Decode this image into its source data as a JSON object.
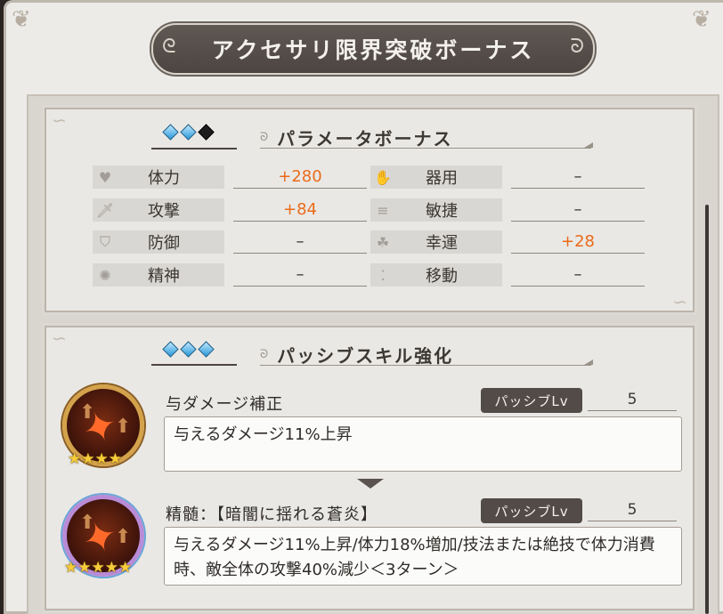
{
  "header": {
    "title": "アクセサリ限界突破ボーナス"
  },
  "param_section": {
    "title": "パラメータボーナス",
    "gems": [
      "blue",
      "blue",
      "black"
    ],
    "stats": [
      {
        "icon": "heart-icon",
        "glyph": "♥",
        "label": "体力",
        "value": "+280",
        "positive": true
      },
      {
        "icon": "hand-icon",
        "glyph": "✋",
        "label": "器用",
        "value": "–",
        "positive": false
      },
      {
        "icon": "sword-icon",
        "glyph": "🗡",
        "label": "攻撃",
        "value": "+84",
        "positive": true
      },
      {
        "icon": "speed-lines-icon",
        "glyph": "≡",
        "label": "敏捷",
        "value": "–",
        "positive": false
      },
      {
        "icon": "shield-icon",
        "glyph": "⛉",
        "label": "防御",
        "value": "–",
        "positive": false
      },
      {
        "icon": "clover-icon",
        "glyph": "☘",
        "label": "幸運",
        "value": "+28",
        "positive": true
      },
      {
        "icon": "spirit-icon",
        "glyph": "✺",
        "label": "精神",
        "value": "–",
        "positive": false
      },
      {
        "icon": "footprints-icon",
        "glyph": "⁚",
        "label": "移動",
        "value": "–",
        "positive": false
      }
    ]
  },
  "passive_section": {
    "title": "パッシブスキル強化",
    "gems": [
      "blue",
      "blue",
      "blue"
    ],
    "skills": [
      {
        "name": "与ダメージ補正",
        "lv_label": "パッシブLv",
        "lv_value": "5",
        "description": "与えるダメージ11%上昇",
        "stars": "★★★★"
      },
      {
        "name": "精髄：【暗闇に揺れる蒼炎】",
        "lv_label": "パッシブLv",
        "lv_value": "5",
        "description": "与えるダメージ11%上昇/体力18%増加/技法または絶技で体力消費時、敵全体の攻撃40%減少＜3ターン＞",
        "stars": "★★★★★"
      }
    ]
  },
  "colors": {
    "accent_orange": "#ea6b1a",
    "banner": "#524b47",
    "gem_blue": "#2a98d8"
  }
}
